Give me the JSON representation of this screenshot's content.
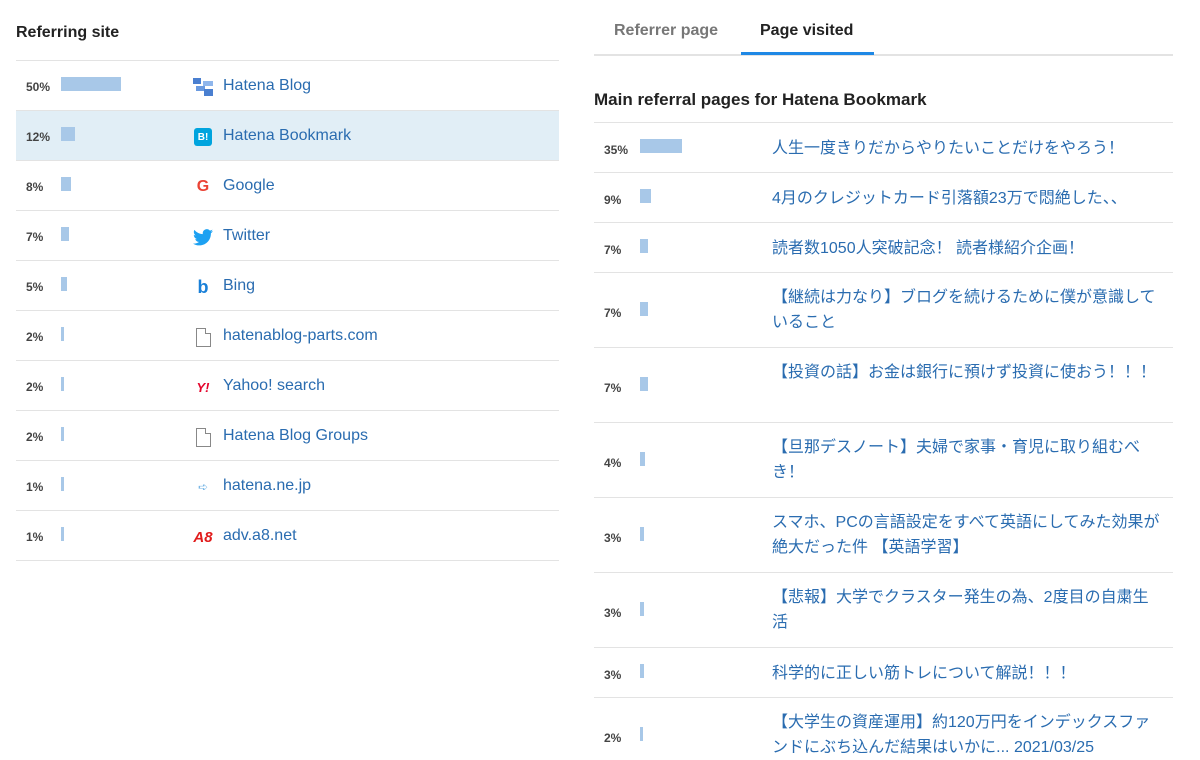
{
  "referring_site": {
    "title": "Referring site",
    "rows": [
      {
        "pct": "50%",
        "share": 0.5,
        "icon": "hatena-blog-icon",
        "name": "Hatena Blog"
      },
      {
        "pct": "12%",
        "share": 0.12,
        "icon": "hatena-bookmark-icon",
        "name": "Hatena Bookmark",
        "selected": true
      },
      {
        "pct": "8%",
        "share": 0.08,
        "icon": "google-icon",
        "name": "Google"
      },
      {
        "pct": "7%",
        "share": 0.07,
        "icon": "twitter-icon",
        "name": "Twitter"
      },
      {
        "pct": "5%",
        "share": 0.05,
        "icon": "bing-icon",
        "name": "Bing"
      },
      {
        "pct": "2%",
        "share": 0.02,
        "icon": "document-icon",
        "name": "hatenablog-parts.com"
      },
      {
        "pct": "2%",
        "share": 0.02,
        "icon": "yahoo-icon",
        "name": "Yahoo! search"
      },
      {
        "pct": "2%",
        "share": 0.02,
        "icon": "document-icon",
        "name": "Hatena Blog Groups"
      },
      {
        "pct": "1%",
        "share": 0.01,
        "icon": "hatena-jp-icon",
        "name": "hatena.ne.jp"
      },
      {
        "pct": "1%",
        "share": 0.01,
        "icon": "a8-icon",
        "name": "adv.a8.net"
      }
    ]
  },
  "tabs": [
    {
      "label": "Referrer page",
      "active": false
    },
    {
      "label": "Page visited",
      "active": true
    }
  ],
  "referral_pages": {
    "title": "Main referral pages for Hatena Bookmark",
    "rows": [
      {
        "pct": "35%",
        "share": 0.35,
        "title": "人生一度きりだからやりたいことだけをやろう！"
      },
      {
        "pct": "9%",
        "share": 0.09,
        "title": "4月のクレジットカード引落額23万で悶絶した、、"
      },
      {
        "pct": "7%",
        "share": 0.07,
        "title": "読者数1050人突破記念！ 読者様紹介企画！"
      },
      {
        "pct": "7%",
        "share": 0.07,
        "title": "【継続は力なり】ブログを続けるために僕が意識していること"
      },
      {
        "pct": "7%",
        "share": 0.07,
        "title": "【投資の話】お金は銀行に預けず投資に使おう！！！"
      },
      {
        "pct": "4%",
        "share": 0.04,
        "title": "【旦那デスノート】夫婦で家事・育児に取り組むべき！"
      },
      {
        "pct": "3%",
        "share": 0.03,
        "title": "スマホ、PCの言語設定をすべて英語にしてみた効果が絶大だった件 【英語学習】"
      },
      {
        "pct": "3%",
        "share": 0.03,
        "title": "【悲報】大学でクラスター発生の為、2度目の自粛生活"
      },
      {
        "pct": "3%",
        "share": 0.03,
        "title": "科学的に正しい筋トレについて解説！！！"
      },
      {
        "pct": "2%",
        "share": 0.02,
        "title": "【大学生の資産運用】約120万円をインデックスファンドにぶち込んだ結果はいかに... 2021/03/25"
      }
    ]
  },
  "colors": {
    "bar": "#a8c8e8",
    "link": "#2a6cb0",
    "selected_row": "#e1eef6",
    "tab_accent": "#1e88e5"
  }
}
